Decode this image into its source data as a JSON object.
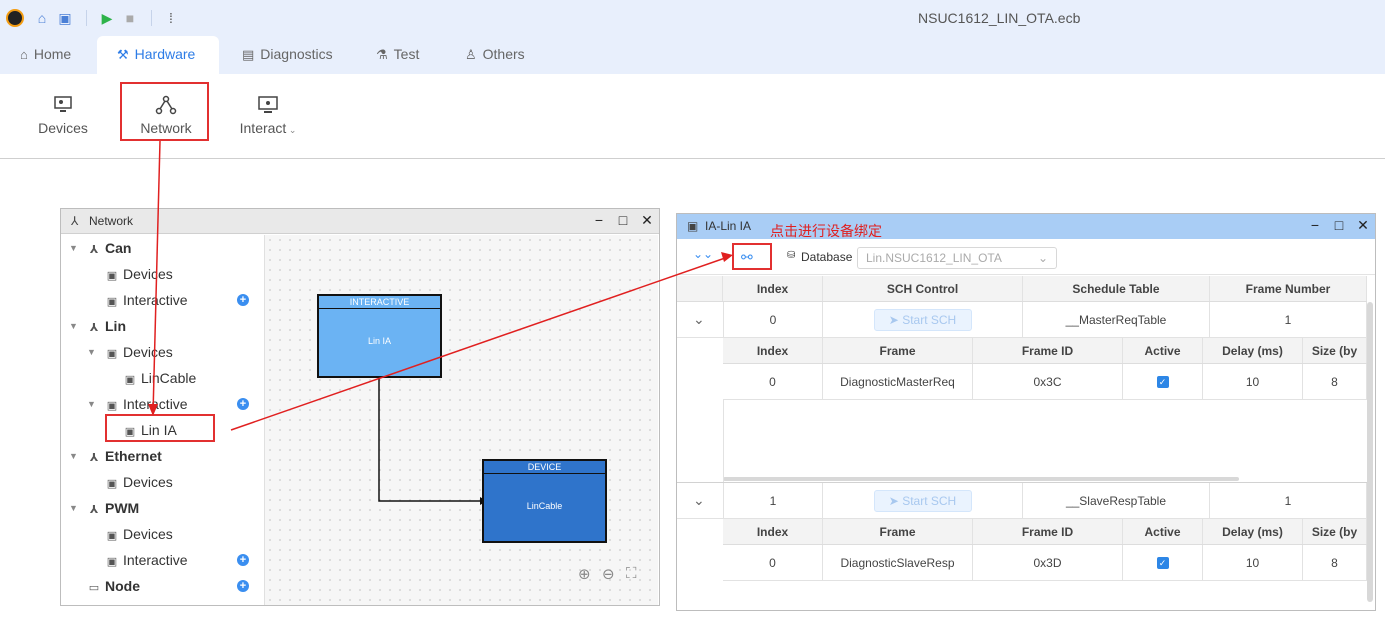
{
  "titlebar": {
    "doc_title": "NSUC1612_LIN_OTA.ecb"
  },
  "tabs": [
    {
      "label": "Home",
      "icon": "home-icon"
    },
    {
      "label": "Hardware",
      "icon": "hardware-icon"
    },
    {
      "label": "Diagnostics",
      "icon": "diagnostics-icon"
    },
    {
      "label": "Test",
      "icon": "flask-icon"
    },
    {
      "label": "Others",
      "icon": "user-icon"
    }
  ],
  "ribbon": {
    "devices": "Devices",
    "network": "Network",
    "interact": "Interact"
  },
  "network_panel": {
    "title": "Network",
    "tree": {
      "can": "Can",
      "can_devices": "Devices",
      "can_interactive": "Interactive",
      "lin": "Lin",
      "lin_devices": "Devices",
      "lin_cable": "LinCable",
      "lin_interactive": "Interactive",
      "lin_ia": "Lin IA",
      "ethernet": "Ethernet",
      "eth_devices": "Devices",
      "pwm": "PWM",
      "pwm_devices": "Devices",
      "pwm_interactive": "Interactive",
      "node": "Node"
    },
    "canvas": {
      "node_interactive": {
        "header": "INTERACTIVE",
        "label": "Lin IA",
        "color": "#6bb3f3"
      },
      "node_device": {
        "header": "DEVICE",
        "label": "LinCable",
        "color": "#2f74cb"
      }
    }
  },
  "ia_panel": {
    "title": "IA-Lin IA",
    "annotation": "点击进行设备绑定",
    "database_label": "Database",
    "database_value": "Lin.NSUC1612_LIN_OTA",
    "main_headers": [
      "Index",
      "SCH Control",
      "Schedule Table",
      "Frame Number"
    ],
    "sub_headers": [
      "Index",
      "Frame",
      "Frame ID",
      "Active",
      "Delay (ms)",
      "Size (by"
    ],
    "rows": [
      {
        "index": "0",
        "sch": "Start SCH",
        "table": "__MasterReqTable",
        "frames": "1",
        "sub": {
          "index": "0",
          "frame": "DiagnosticMasterReq",
          "id": "0x3C",
          "delay": "10",
          "size": "8"
        }
      },
      {
        "index": "1",
        "sch": "Start SCH",
        "table": "__SlaveRespTable",
        "frames": "1",
        "sub": {
          "index": "0",
          "frame": "DiagnosticSlaveResp",
          "id": "0x3D",
          "delay": "10",
          "size": "8"
        }
      }
    ]
  }
}
